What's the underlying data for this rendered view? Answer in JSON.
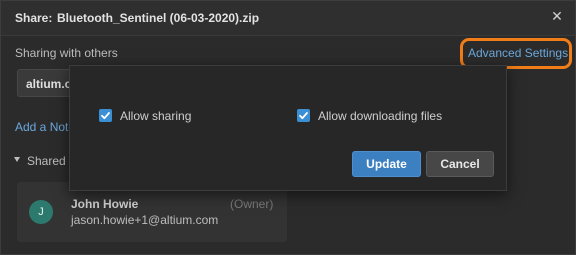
{
  "dialog": {
    "title_prefix": "Share:",
    "file_name": "Bluetooth_Sentinel (06-03-2020).zip",
    "close_icon": "close-icon"
  },
  "sharing": {
    "label": "Sharing with others",
    "advanced_settings_link": "Advanced Settings",
    "email_value": "altium.cl"
  },
  "note": {
    "add_note_link": "Add a Note"
  },
  "shared_section": {
    "label": "Shared w",
    "users": [
      {
        "avatar_initial": "J",
        "name": "John Howie",
        "role": "(Owner)",
        "email": "jason.howie+1@altium.com"
      }
    ]
  },
  "advanced_popup": {
    "allow_sharing": {
      "label": "Allow sharing",
      "checked": true
    },
    "allow_downloading": {
      "label": "Allow downloading files",
      "checked": true
    },
    "update_label": "Update",
    "cancel_label": "Cancel"
  },
  "colors": {
    "accent": "#3d80c2",
    "link": "#6aa8dc",
    "highlight": "#f07d18",
    "avatar": "#2c7a6e"
  }
}
